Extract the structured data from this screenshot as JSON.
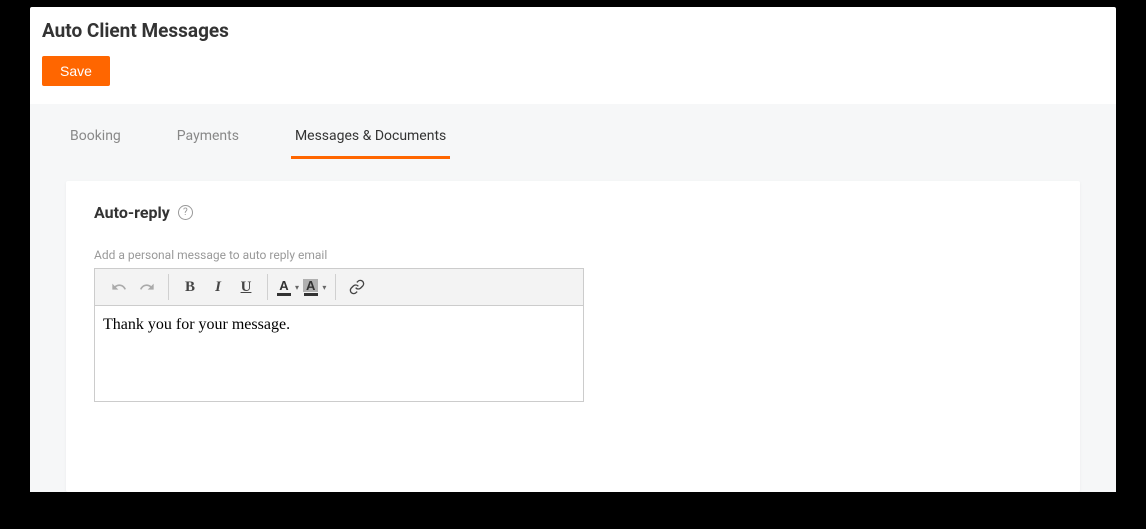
{
  "header": {
    "title": "Auto Client Messages",
    "save_label": "Save"
  },
  "tabs": [
    {
      "label": "Booking",
      "active": false
    },
    {
      "label": "Payments",
      "active": false
    },
    {
      "label": "Messages & Documents",
      "active": true
    }
  ],
  "section": {
    "title": "Auto-reply",
    "field_label": "Add a personal message to auto reply email",
    "content": "Thank you for your message."
  }
}
